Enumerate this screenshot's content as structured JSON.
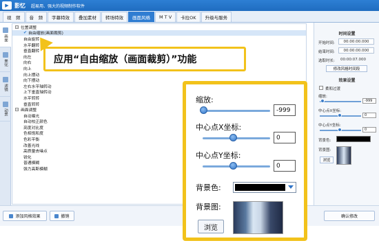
{
  "titlebar": {
    "app_name": "影忆",
    "slogan": "超易用、强大的视频制作软件"
  },
  "menubar": {
    "tabs": [
      "视　频",
      "音　频",
      "字幕特效",
      "叠加素材",
      "转场特效",
      "画面风格",
      "M T V",
      "卡拉OK",
      "升级与服务"
    ],
    "active_index": 5
  },
  "lefttabs": [
    {
      "label": "画面",
      "active": true
    },
    {
      "label": "美化",
      "active": false
    },
    {
      "label": "滤镜",
      "active": false
    },
    {
      "label": "动景",
      "active": false
    }
  ],
  "tree": {
    "cat1": "位置调整",
    "items1": [
      "自由缩放(画面裁剪)",
      "自由旋转",
      "水平翻转",
      "垂直翻转",
      "向左",
      "向右",
      "向上",
      "向上摆动",
      "向下摆动",
      "左右水平轴转动",
      "上下垂直轴转动",
      "水平转转",
      "垂直转转"
    ],
    "cat2": "画面调整",
    "items2": [
      "自动曝光",
      "自动校正颜色",
      "亮度对比度",
      "色相饱和度",
      "色彩平衡",
      "改善光线",
      "高质量去噪点",
      "锐化",
      "普通模糊",
      "强力高斯模糊"
    ]
  },
  "bottom": {
    "add_btn": "添加风格效果",
    "undo_btn": "撤销",
    "confirm_btn": "确认修改"
  },
  "rpanel": {
    "time_title": "时间设置",
    "start_label": "开始时间:",
    "start_value": "00:00:00.000",
    "end_label": "结束时间:",
    "end_value": "00:00:00.000",
    "dur_label": "选取时长:",
    "dur_value": "00:00:07.000",
    "modify_btn": "修改风格时间段",
    "effect_title": "效果设置",
    "soft_label": "柔和过渡",
    "zoom_label": "缩放:",
    "zoom_value": "-999",
    "cx_label": "中心点X坐标:",
    "cx_value": "0",
    "cy_label": "中心点Y坐标:",
    "cy_value": "0",
    "bg_color_label": "背景色:",
    "bg_img_label": "背景图:",
    "browse_btn": "浏览"
  },
  "banner": {
    "text": "应用“自由缩放（画面裁剪）”功能"
  },
  "zoom": {
    "zoom_label": "缩放:",
    "zoom_value": "-999",
    "cx_label": "中心点X坐标:",
    "cx_value": "0",
    "cy_label": "中心点Y坐标:",
    "cy_value": "0",
    "bg_color_label": "背景色:",
    "bg_img_label": "背景图:",
    "browse_btn": "浏览",
    "bg_color": "#000000",
    "accent": "#f2c21b"
  }
}
